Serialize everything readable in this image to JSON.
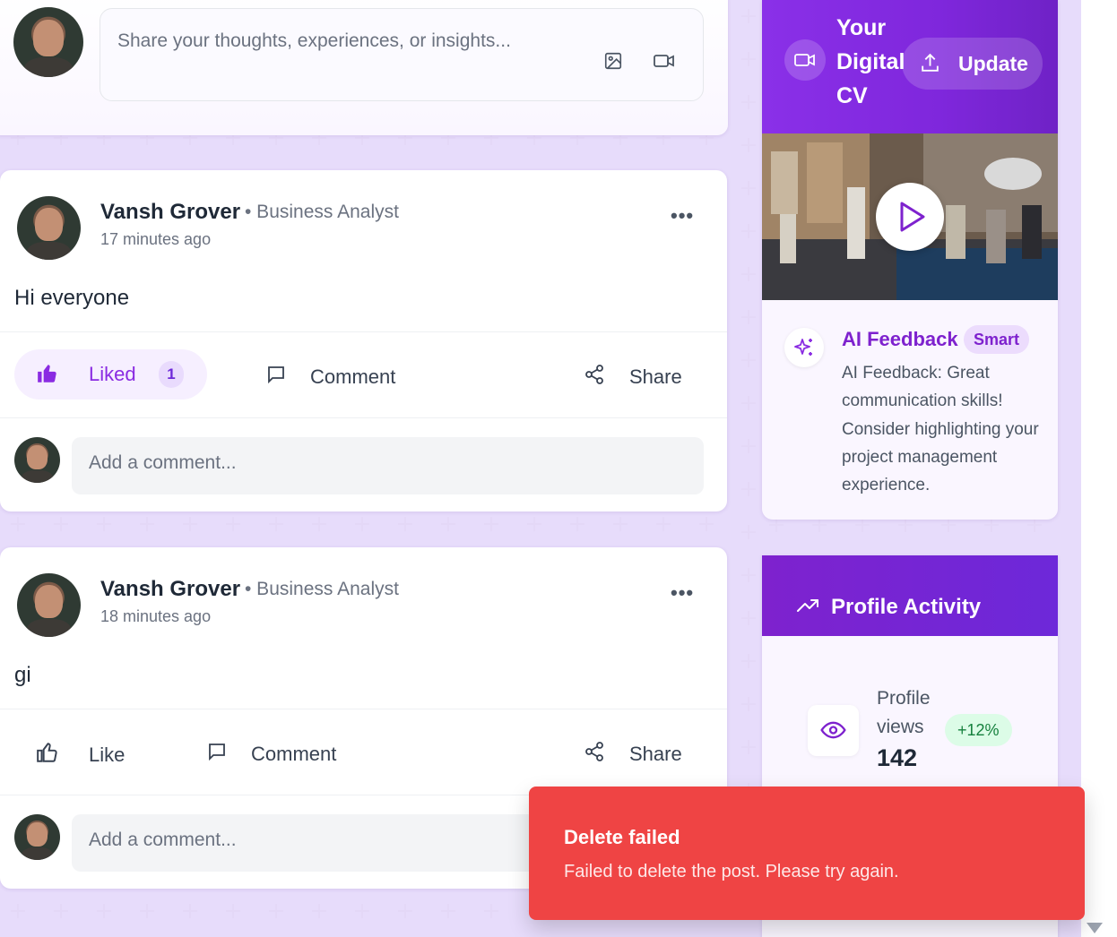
{
  "composer": {
    "placeholder": "Share your thoughts, experiences, or insights...",
    "icons": [
      "image-icon",
      "video-icon"
    ]
  },
  "posts": [
    {
      "author": "Vansh Grover",
      "role": "• Business Analyst",
      "time": "17 minutes ago",
      "body": "Hi everyone",
      "like_label": "Liked",
      "like_count": "1",
      "liked": true,
      "comment_label": "Comment",
      "share_label": "Share",
      "comment_placeholder": "Add a comment..."
    },
    {
      "author": "Vansh Grover",
      "role": "• Business Analyst",
      "time": "18 minutes ago",
      "body": "gi",
      "like_label": "Like",
      "liked": false,
      "comment_label": "Comment",
      "share_label": "Share",
      "comment_placeholder": "Add a comment..."
    }
  ],
  "digital_cv": {
    "title": "Your Digital CV",
    "update_label": "Update"
  },
  "ai_feedback": {
    "title": "AI Feedback",
    "badge": "Smart",
    "text": "AI Feedback: Great communication skills! Consider highlighting your project management experience."
  },
  "profile_activity": {
    "title": "Profile Activity",
    "views_label": "Profile views",
    "views_value": "142",
    "views_delta": "+12%"
  },
  "toast": {
    "title": "Delete failed",
    "message": "Failed to delete the post. Please try again."
  },
  "colors": {
    "accent": "#8a2be2",
    "toast_bg": "#ef4444",
    "page_bg": "#f6f1ff"
  }
}
